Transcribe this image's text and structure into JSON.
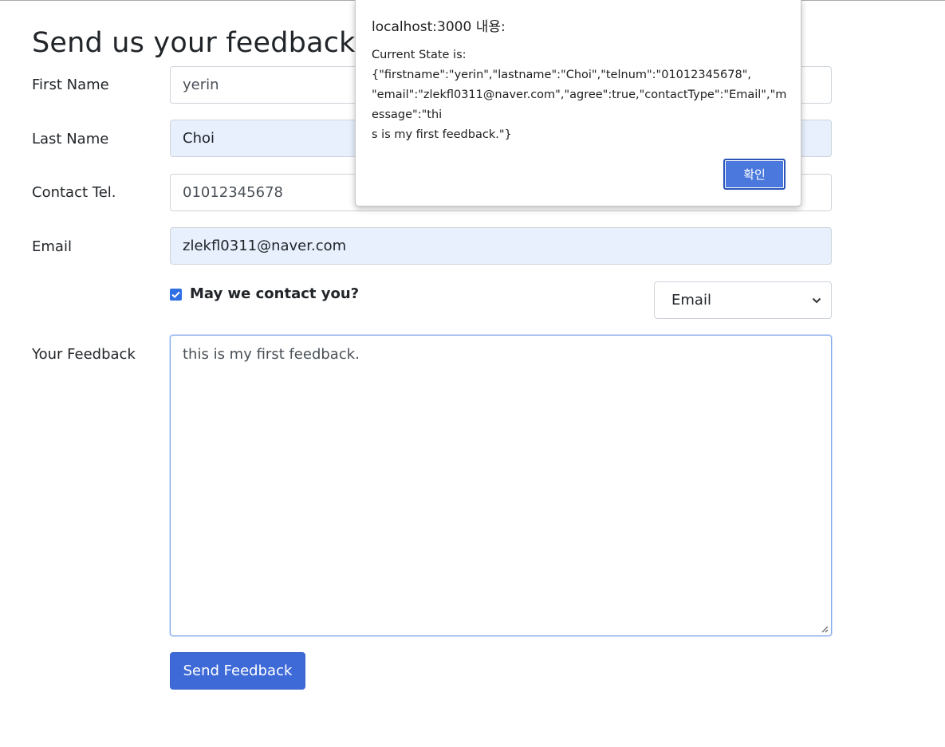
{
  "form": {
    "title": "Send us your feedback",
    "firstname": {
      "label": "First Name",
      "value": "yerin"
    },
    "lastname": {
      "label": "Last Name",
      "value": "Choi"
    },
    "telnum": {
      "label": "Contact Tel.",
      "value": "01012345678"
    },
    "email": {
      "label": "Email",
      "value": "zlekfl0311@naver.com"
    },
    "agree": {
      "label": "May we contact you?",
      "checked": true
    },
    "contactType": {
      "selected": "Email"
    },
    "message": {
      "label": "Your Feedback",
      "value": "this is my first feedback."
    },
    "submit_label": "Send Feedback"
  },
  "alert": {
    "title": "localhost:3000 내용:",
    "message": "Current State is:\n{\"firstname\":\"yerin\",\"lastname\":\"Choi\",\"telnum\":\"01012345678\",\n\"email\":\"zlekfl0311@naver.com\",\"agree\":true,\"contactType\":\"Email\",\"message\":\"thi\ns is my first feedback.\"}",
    "ok_label": "확인"
  },
  "colors": {
    "primary_button": "#3e6ad8",
    "autofill_background": "#e8f0fe",
    "checkbox": "#2f6fe4"
  },
  "icons": {
    "select_arrow": "chevron-down-icon",
    "checkbox_mark": "check-icon",
    "resize_grip": "resize-grip-icon"
  }
}
